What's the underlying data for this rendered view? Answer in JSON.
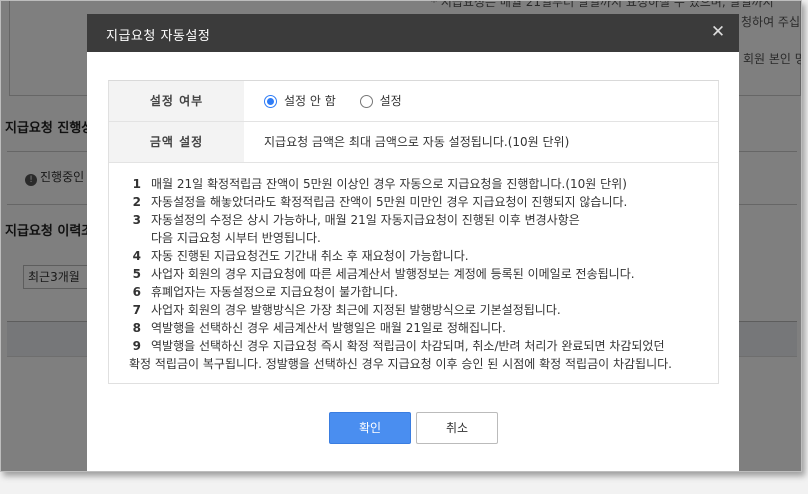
{
  "background": {
    "note1": "* 지급요청은 매월 21일부터 말일까지 요청하실 수 있으며, 말일까지",
    "note2": "청하여 주십",
    "note3": "회원 본인 명",
    "section_progress_title": "지급요청 진행상",
    "status_label": "진행중인",
    "section_history_title": "지급요청 이력조",
    "period_select": "최근3개월"
  },
  "modal": {
    "title": "지급요청 자동설정",
    "close_icon": "close-icon",
    "rows": [
      {
        "label": "설정 여부",
        "options": [
          {
            "label": "설정 안 함",
            "checked": true
          },
          {
            "label": "설정",
            "checked": false
          }
        ]
      },
      {
        "label": "금액 설정",
        "value": "지급요청 금액은 최대 금액으로 자동 설정됩니다.(10원 단위)"
      }
    ],
    "notes": [
      {
        "num": "1",
        "text": "매월 21일 확정적립금 잔액이 5만원 이상인 경우 자동으로 지급요청을 진행합니다.(10원 단위)"
      },
      {
        "num": "2",
        "text": "자동설정을 해놓았더라도 확정적립금 잔액이 5만원 미만인 경우 지급요청이 진행되지 않습니다."
      },
      {
        "num": "3",
        "text": "자동설정의 수정은 상시 가능하나, 매월 21일 자동지급요청이 진행된 이후 변경사항은"
      },
      {
        "num": "",
        "text": "다음 지급요청 시부터 반영됩니다."
      },
      {
        "num": "4",
        "text": "자동 진행된 지급요청건도 기간내 취소 후 재요청이 가능합니다."
      },
      {
        "num": "5",
        "text": "사업자 회원의 경우 지급요청에 따른 세금계산서 발행정보는 계정에 등록된 이메일로 전송됩니다."
      },
      {
        "num": "6",
        "text": "휴폐업자는 자동설정으로 지급요청이 불가합니다."
      },
      {
        "num": "7",
        "text": "사업자 회원의 경우 발행방식은 가장 최근에 지정된 발행방식으로 기본설정됩니다."
      },
      {
        "num": "8",
        "text": "역발행을 선택하신 경우 세금계산서 발행일은 매월 21일로 정해집니다."
      },
      {
        "num": "9",
        "text": "역발행을 선택하신 경우 지급요청 즉시 확정 적립금이 차감되며, 취소/반려 처리가 완료되면 차감되었던"
      }
    ],
    "note_continuation": "확정 적립금이 복구됩니다. 정발행을 선택하신 경우 지급요청 이후 승인 된 시점에 확정 적립금이 차감됩니다.",
    "confirm_label": "확인",
    "cancel_label": "취소",
    "accent_color": "#4a8ef0"
  }
}
